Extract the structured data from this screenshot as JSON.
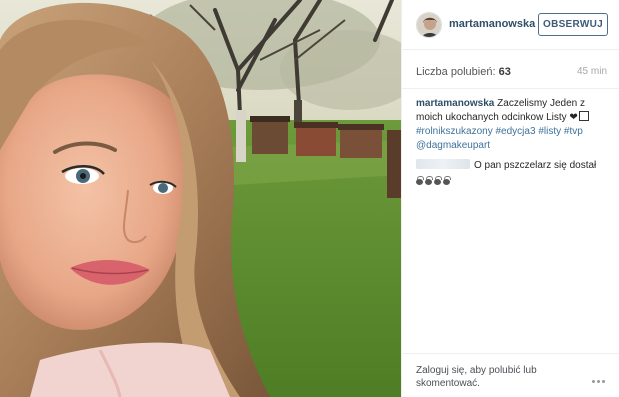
{
  "header": {
    "username": "martamanowska",
    "follow_label": "OBSERWUJ"
  },
  "stats": {
    "likes_label": "Liczba polubień:",
    "likes_count": "63",
    "time_ago": "45 min"
  },
  "caption": {
    "username": "martamanowska",
    "text": "Zaczelismy Jeden z moich ukochanych odcinkow Listy",
    "hashtags": [
      "#rolnikszukazony",
      "#edycja3",
      "#listy",
      "#tvp"
    ],
    "mention": "@dagmakeupart"
  },
  "comment": {
    "text": "O pan pszczelarz się dostał"
  },
  "footer": {
    "login_prompt": "Zaloguj się, aby polubić lub skomentować."
  },
  "colors": {
    "link": "#3f729b",
    "username": "#2f4f68",
    "follow_border": "#4e6f8c"
  },
  "icons": [
    "heart-icon",
    "more-options-icon",
    "bee-emoji-icon"
  ]
}
